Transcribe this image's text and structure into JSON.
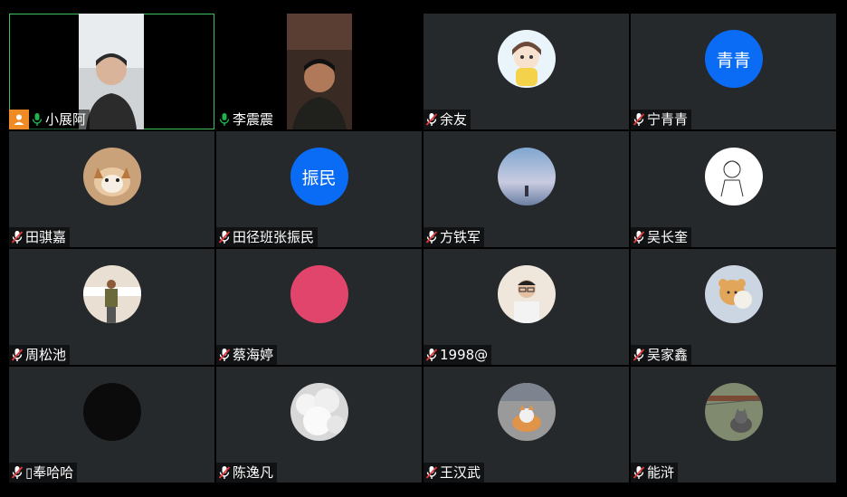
{
  "participants": [
    {
      "name": "小展阿",
      "type": "video",
      "mic": "on",
      "host": true,
      "active": true
    },
    {
      "name": "李震震",
      "type": "video",
      "mic": "on",
      "host": false,
      "active": false
    },
    {
      "name": "余友",
      "type": "avatar",
      "mic": "off",
      "avatar_style": "cartoon-girl"
    },
    {
      "name": "宁青青",
      "type": "text",
      "mic": "off",
      "avatar_text": "青青",
      "avatar_color": "#0a6cf5"
    },
    {
      "name": "田骐嘉",
      "type": "avatar",
      "mic": "off",
      "avatar_style": "dog"
    },
    {
      "name": "田径班张振民",
      "type": "text",
      "mic": "off",
      "avatar_text": "振民",
      "avatar_color": "#0a6cf5"
    },
    {
      "name": "方铁军",
      "type": "avatar",
      "mic": "off",
      "avatar_style": "sky"
    },
    {
      "name": "吴长奎",
      "type": "avatar",
      "mic": "off",
      "avatar_style": "sketch"
    },
    {
      "name": "周松池",
      "type": "avatar",
      "mic": "off",
      "avatar_style": "person-outdoor"
    },
    {
      "name": "蔡海婷",
      "type": "avatar",
      "mic": "off",
      "avatar_style": "pink",
      "avatar_color": "#e2456b"
    },
    {
      "name": "1998@",
      "type": "avatar",
      "mic": "off",
      "avatar_style": "man-glasses"
    },
    {
      "name": "吴家鑫",
      "type": "avatar",
      "mic": "off",
      "avatar_style": "bear"
    },
    {
      "name": "奉哈哈",
      "type": "avatar",
      "mic": "off",
      "avatar_style": "black",
      "name_prefix": "▯"
    },
    {
      "name": "陈逸凡",
      "type": "avatar",
      "mic": "off",
      "avatar_style": "clouds"
    },
    {
      "name": "王汉武",
      "type": "avatar",
      "mic": "off",
      "avatar_style": "cat-road"
    },
    {
      "name": "能浒",
      "type": "avatar",
      "mic": "off",
      "avatar_style": "cat-fence"
    }
  ],
  "colors": {
    "tile_bg": "#26292c",
    "mic_on": "#21b24b",
    "mic_off_slash": "#e0393e",
    "host_badge": "#f08a24",
    "active_border": "#3fbf5c"
  }
}
